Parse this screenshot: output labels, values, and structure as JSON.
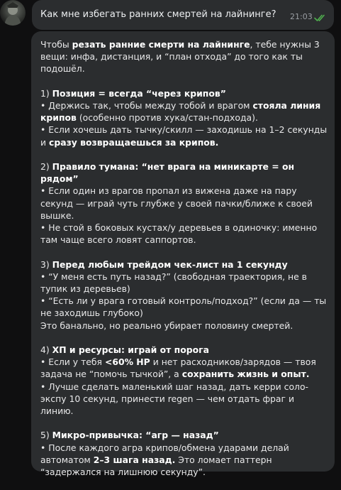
{
  "user_message": {
    "text": "Как мне избегать ранних смертей на лайнинге?",
    "time": "21:03",
    "status_icon": "double-check-icon",
    "check_color": "#4fae4e"
  },
  "bot_message": {
    "intro": {
      "p1": "Чтобы ",
      "b1": "резать ранние смерти на лайнинге",
      "p2": ", тебе нужны 3 вещи: инфа, дистанция, и “план отхода” до того как ты подошёл."
    },
    "s1": {
      "num": "1) ",
      "title": "Позиция = всегда “через крипов”",
      "l1_a": "• Держись так, чтобы между тобой и врагом ",
      "l1_b": "стояла линия крипов",
      "l1_c": " (особенно против хука/стан-подхода).",
      "l2_a": "• Если хочешь дать тычку/скилл — заходишь на 1–2 секунды и ",
      "l2_b": "сразу возвращаешься за крипов."
    },
    "s2": {
      "num": "2) ",
      "title": "Правило тумана: “нет врага на миникарте = он рядом”",
      "l1": "• Если один из врагов пропал из вижена даже на пару секунд — играй чуть глубже у своей пачки/ближе к своей вышке.",
      "l2": "• Не стой в боковых кустах/у деревьев в одиночку: именно там чаще всего ловят саппортов."
    },
    "s3": {
      "num": "3) ",
      "title": "Перед любым трейдом чек-лист на 1 секунду",
      "l1": "• “У меня есть путь назад?” (свободная траектория, не в тупик из деревьев)",
      "l2": "• “Есть ли у врага готовый контроль/подход?” (если да — ты не заходишь глубоко)",
      "l3": "Это банально, но реально убирает половину смертей."
    },
    "s4": {
      "num": "4) ",
      "title": "ХП и ресурсы: играй от порога",
      "l1_a": "• Если у тебя ",
      "l1_b": "<60% HP",
      "l1_c": " и нет расходников/зарядов — твоя задача не “помочь тычкой”, а ",
      "l1_d": "сохранить жизнь и опыт.",
      "l2": "• Лучше сделать маленький шаг назад, дать керри соло-экспу 10 секунд, принести regen — чем отдать фраг и линию."
    },
    "s5": {
      "num": "5) ",
      "title": "Микро-привычка: “агр — назад”",
      "l1_a": "• После каждого агра крипов/обмена ударами делай автоматом ",
      "l1_b": "2–3 шага назад.",
      "l1_c": " Это ломает паттерн “задержался на лишнюю секунду”."
    }
  }
}
